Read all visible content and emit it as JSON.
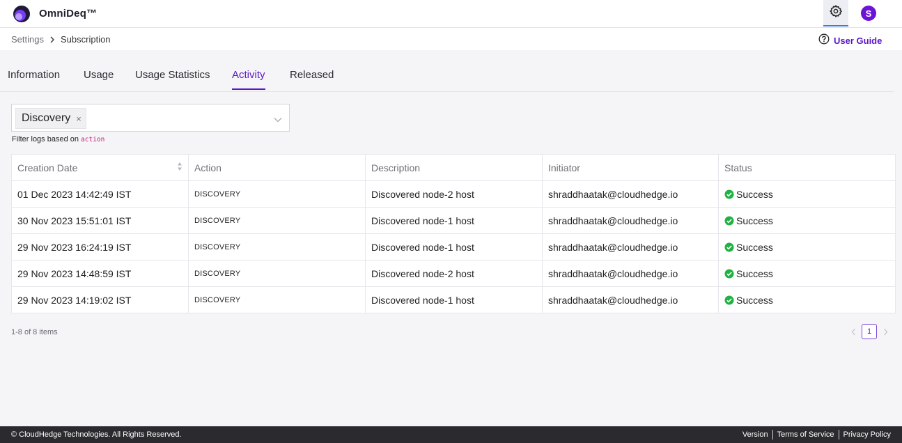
{
  "app": {
    "title": "OmniDeq™",
    "avatar_initial": "S"
  },
  "breadcrumb": {
    "parent": "Settings",
    "current": "Subscription"
  },
  "help": {
    "label": "User Guide"
  },
  "tabs": [
    {
      "label": "Information"
    },
    {
      "label": "Usage"
    },
    {
      "label": "Usage Statistics"
    },
    {
      "label": "Activity",
      "active": true
    },
    {
      "label": "Released"
    }
  ],
  "filter": {
    "selected": "Discovery",
    "remove_glyph": "×",
    "help_text": "Filter logs based on",
    "help_code": "action"
  },
  "table": {
    "columns": [
      "Creation Date",
      "Action",
      "Description",
      "Initiator",
      "Status"
    ],
    "rows": [
      {
        "date": "01 Dec 2023 14:42:49 IST",
        "action": "DISCOVERY",
        "description": "Discovered node-2 host",
        "initiator": "shraddhaatak@cloudhedge.io",
        "status": "Success"
      },
      {
        "date": "30 Nov 2023 15:51:01 IST",
        "action": "DISCOVERY",
        "description": "Discovered node-1 host",
        "initiator": "shraddhaatak@cloudhedge.io",
        "status": "Success"
      },
      {
        "date": "29 Nov 2023 16:24:19 IST",
        "action": "DISCOVERY",
        "description": "Discovered node-1 host",
        "initiator": "shraddhaatak@cloudhedge.io",
        "status": "Success"
      },
      {
        "date": "29 Nov 2023 14:48:59 IST",
        "action": "DISCOVERY",
        "description": "Discovered node-2 host",
        "initiator": "shraddhaatak@cloudhedge.io",
        "status": "Success"
      },
      {
        "date": "29 Nov 2023 14:19:02 IST",
        "action": "DISCOVERY",
        "description": "Discovered node-1 host",
        "initiator": "shraddhaatak@cloudhedge.io",
        "status": "Success"
      }
    ]
  },
  "pagination": {
    "summary": "1-8 of 8 items",
    "current_page": "1"
  },
  "footer": {
    "copyright": "© CloudHedge Technologies. All Rights Reserved.",
    "links": [
      "Version",
      "Terms of Service",
      "Privacy Policy"
    ]
  },
  "colors": {
    "accent": "#5b17c9",
    "success": "#1fb141",
    "footer_bg": "#2b2b2f",
    "selected_tab_underline": "#3b7ddd"
  },
  "icons": {
    "logo": "omnideq-logo-icon",
    "settings": "gear-icon",
    "breadcrumb_separator": "chevron-right-icon",
    "help": "question-circle-icon",
    "filter_dropdown": "chevron-down-icon",
    "sort": "sort-icon",
    "status": "check-circle-icon",
    "prev": "chevron-left-icon",
    "next": "chevron-right-icon"
  }
}
